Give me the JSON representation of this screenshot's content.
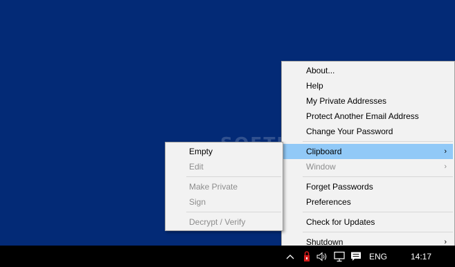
{
  "watermark": "SOFTPEDIA",
  "main_menu": {
    "items": [
      {
        "label": "About..."
      },
      {
        "label": "Help"
      },
      {
        "label": "My Private Addresses"
      },
      {
        "label": "Protect Another Email Address"
      },
      {
        "label": "Change Your Password"
      },
      {
        "label": "Clipboard",
        "arrow": "›"
      },
      {
        "label": "Window",
        "arrow": "›"
      },
      {
        "label": "Forget Passwords"
      },
      {
        "label": "Preferences"
      },
      {
        "label": "Check for Updates"
      },
      {
        "label": "Shutdown",
        "arrow": "›"
      }
    ]
  },
  "sub_menu": {
    "items": [
      {
        "label": "Empty"
      },
      {
        "label": "Edit"
      },
      {
        "label": "Make Private"
      },
      {
        "label": "Sign"
      },
      {
        "label": "Decrypt / Verify"
      }
    ]
  },
  "taskbar": {
    "language": "ENG",
    "time": "14:17",
    "icons": [
      "chevron-up-icon",
      "app-lock-icon",
      "volume-icon",
      "network-icon",
      "notification-icon"
    ]
  },
  "colors": {
    "desktop": "#032a76",
    "menu_bg": "#f2f2f2",
    "highlight": "#91c9f7",
    "disabled_text": "#8d8d8d"
  }
}
